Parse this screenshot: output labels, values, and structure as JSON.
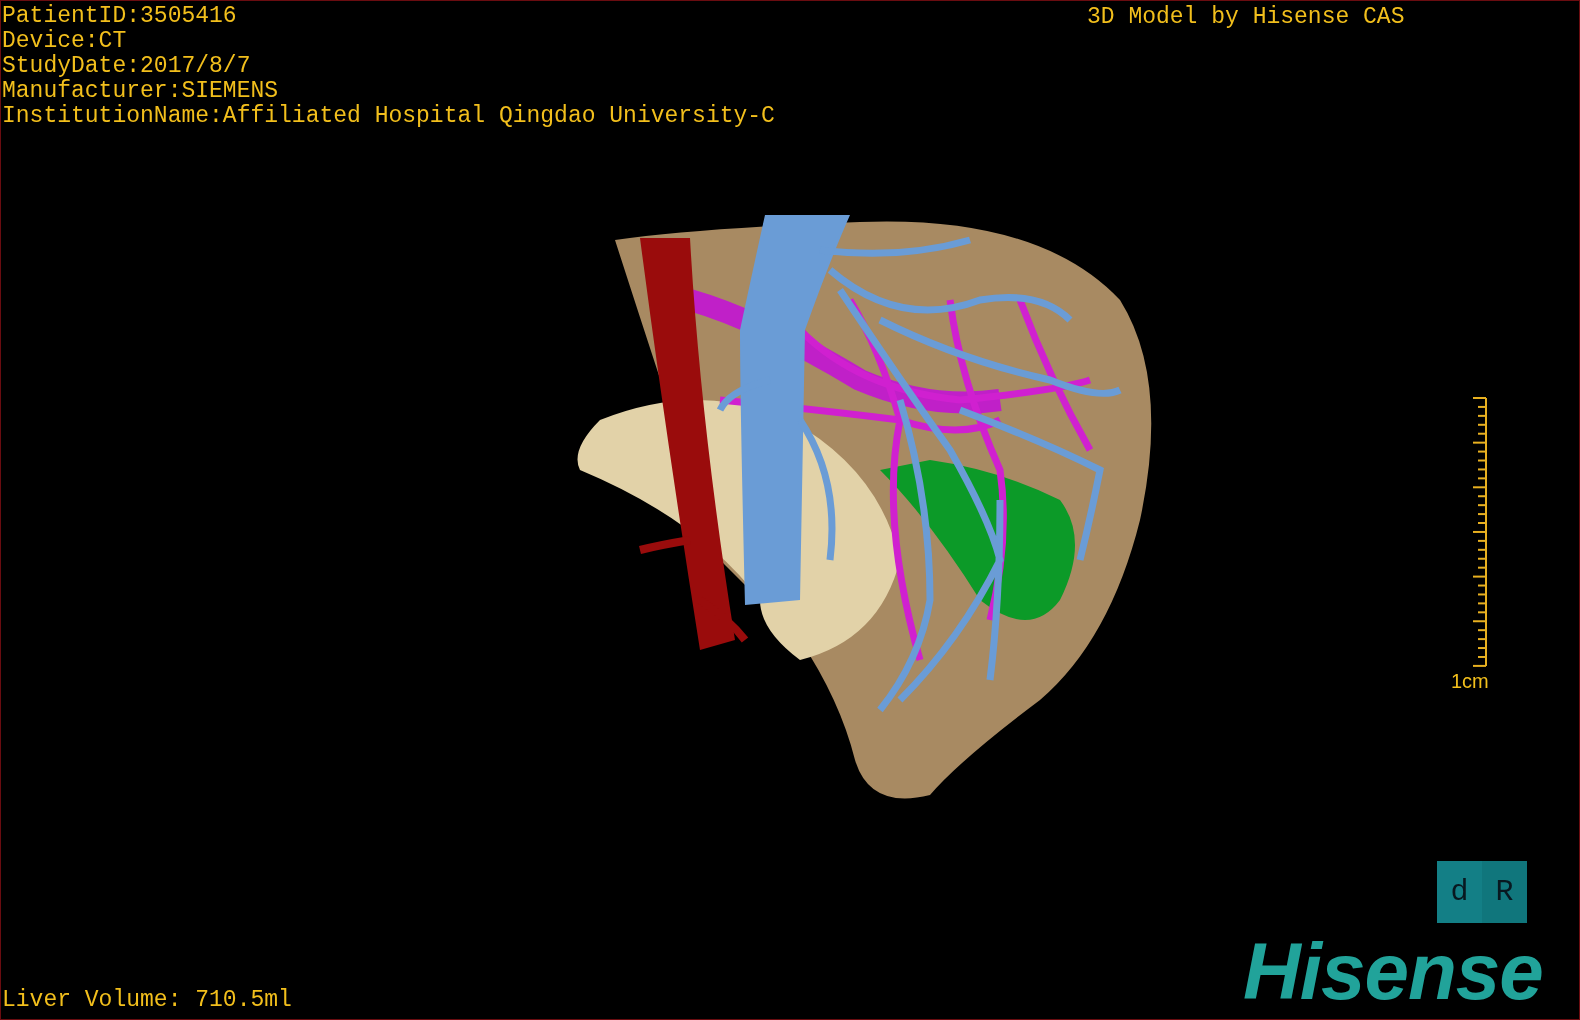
{
  "patient_info": [
    "PatientID:3505416",
    "Device:CT",
    "StudyDate:2017/8/7",
    "Manufacturer:SIEMENS",
    "InstitutionName:Affiliated Hospital Qingdao University-C"
  ],
  "model_credit": "3D Model by Hisense CAS",
  "scale_bar": {
    "label": "1cm"
  },
  "orientation_marker": {
    "left": "d",
    "right": "R"
  },
  "brand": "Hisense",
  "liver_volume": "Liver Volume: 710.5ml"
}
